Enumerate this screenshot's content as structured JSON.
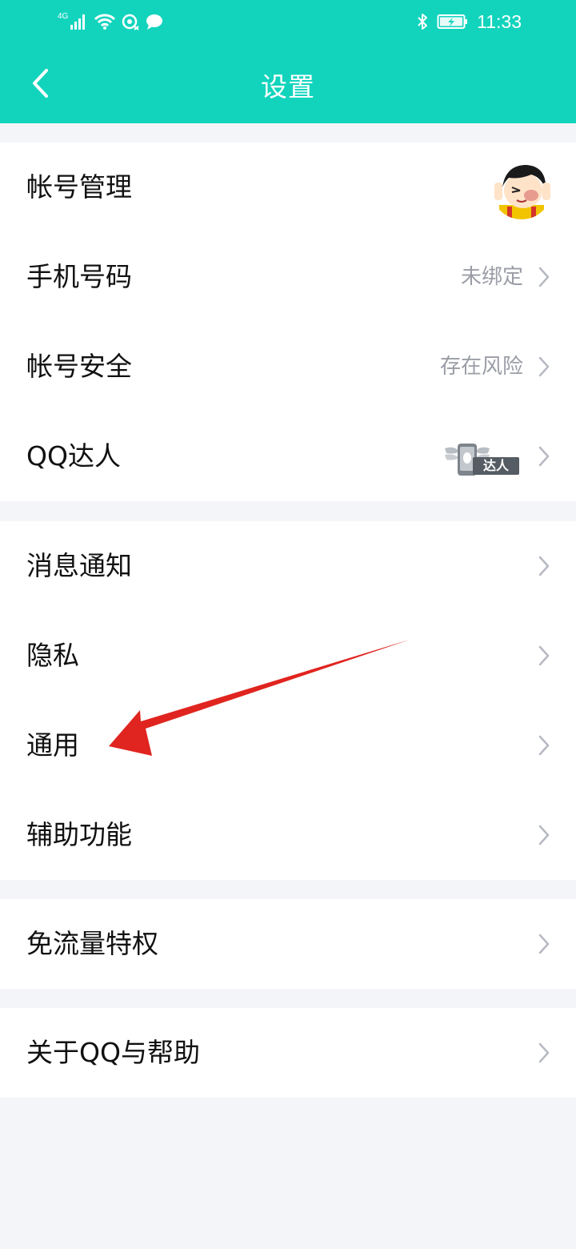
{
  "status": {
    "signal_label": "4G",
    "time": "11:33"
  },
  "header": {
    "title": "设置",
    "back_icon": "chevron-left-icon"
  },
  "groups": [
    {
      "items": [
        {
          "label": "帐号管理",
          "value": "",
          "trailing": "avatar"
        },
        {
          "label": "手机号码",
          "value": "未绑定",
          "trailing": "chevron"
        },
        {
          "label": "帐号安全",
          "value": "存在风险",
          "trailing": "chevron"
        },
        {
          "label": "QQ达人",
          "value": "",
          "badge_text": "达人",
          "trailing": "chevron"
        }
      ]
    },
    {
      "items": [
        {
          "label": "消息通知",
          "trailing": "chevron"
        },
        {
          "label": "隐私",
          "trailing": "chevron"
        },
        {
          "label": "通用",
          "trailing": "chevron"
        },
        {
          "label": "辅助功能",
          "trailing": "chevron"
        }
      ]
    },
    {
      "items": [
        {
          "label": "免流量特权",
          "trailing": "chevron"
        }
      ]
    },
    {
      "items": [
        {
          "label": "关于QQ与帮助",
          "trailing": "chevron"
        }
      ]
    }
  ],
  "colors": {
    "accent": "#12d4bd",
    "background": "#f4f5f9",
    "annotation_arrow": "#e0241f"
  }
}
